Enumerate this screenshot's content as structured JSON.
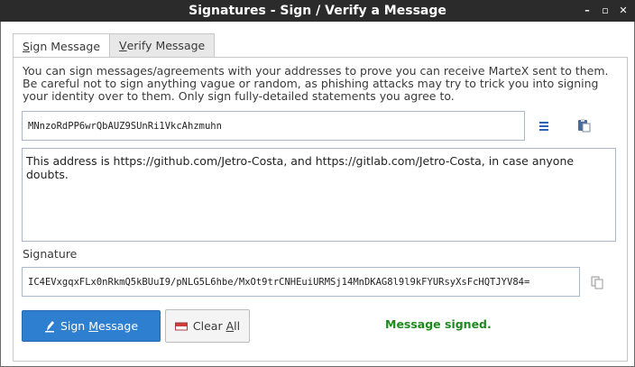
{
  "window": {
    "title": "Signatures - Sign / Verify a Message",
    "controls": {
      "minimize": "–",
      "maximize": "▫",
      "close": "✕"
    }
  },
  "tabs": [
    {
      "label_first": "S",
      "label_rest": "ign Message",
      "active": true
    },
    {
      "label_first": "V",
      "label_rest": "erify Message",
      "active": false
    }
  ],
  "sign": {
    "description": "You can sign messages/agreements with your addresses to prove you can receive MarteX sent to them. Be careful not to sign anything vague or random, as phishing attacks may try to trick you into signing your identity over to them. Only sign fully-detailed statements you agree to.",
    "address_value": "MNnzoRdPP6wrQbAUZ9SUnRi1VkcAhzmuhn",
    "message_text": "This address is https://github.com/Jetro-Costa, and https://gitlab.com/Jetro-Costa, in case anyone doubts.",
    "signature_label": "Signature",
    "signature_value": "IC4EVxgqxFLx0nRkmQ5kBUuI9/pNLG5L6hbe/MxOt9trCNHEuiURMSj14MnDKAG8l9l9kFYURsyXsFcHQTJYV84=",
    "sign_button": {
      "pre": "Sign ",
      "u": "M",
      "post": "essage"
    },
    "clear_button": {
      "pre": "Clear ",
      "u": "A",
      "post": "ll"
    },
    "status": "Message signed."
  },
  "icons": {
    "address_book": "address-book-icon",
    "paste": "paste-icon",
    "copy": "copy-icon",
    "sign": "pen-icon",
    "clear": "eraser-icon"
  },
  "colors": {
    "titlebar": "#2b2b2b",
    "primary_button": "#2f7fd0",
    "status_text": "#1e8a1e",
    "input_border": "#a8b8c8"
  }
}
